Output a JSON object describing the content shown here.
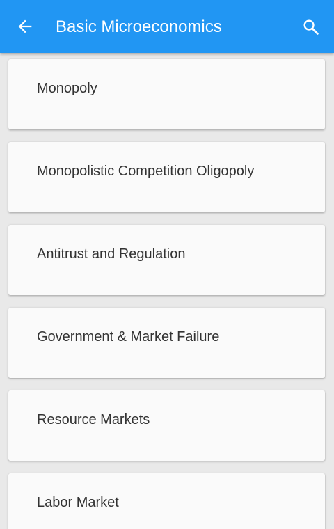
{
  "app_bar": {
    "title": "Basic Microeconomics",
    "back_icon": "arrow-left-icon",
    "search_icon": "search-icon",
    "color": "#2196f3",
    "text_color": "#ffffff"
  },
  "topics": [
    {
      "label": "Monopoly"
    },
    {
      "label": "Monopolistic Competition Oligopoly"
    },
    {
      "label": "Antitrust and Regulation"
    },
    {
      "label": "Government & Market Failure"
    },
    {
      "label": "Resource Markets"
    },
    {
      "label": "Labor Market"
    }
  ]
}
